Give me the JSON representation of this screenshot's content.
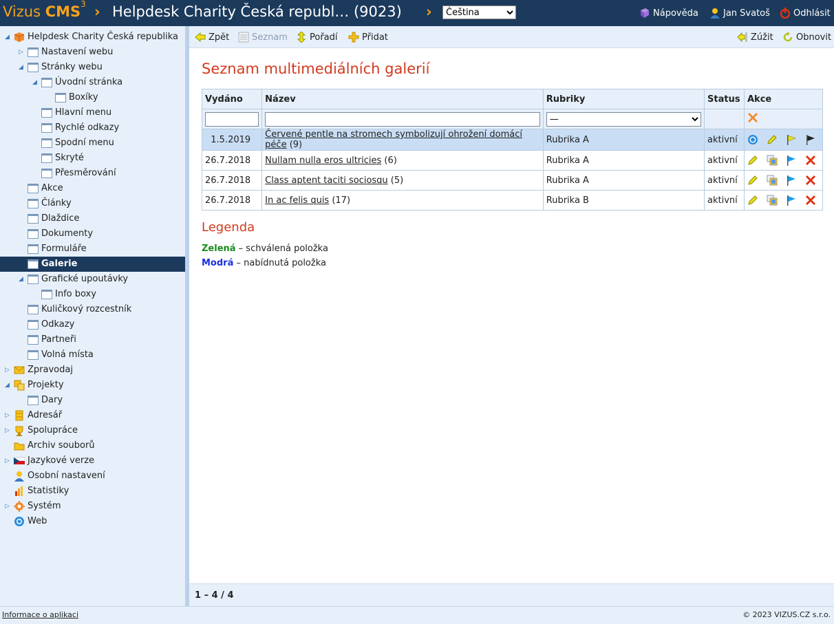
{
  "header": {
    "logo_text": "Vizus ",
    "logo_bold": "CMS",
    "logo_sup": "3",
    "site_title": "Helpdesk Charity Česká republ… (9023)",
    "language_selected": "Čeština",
    "help_label": "Nápověda",
    "user_label": "Jan Svatoš",
    "logout_label": "Odhlásit"
  },
  "sidebar": {
    "items": [
      {
        "label": "Helpdesk Charity Česká republika"
      },
      {
        "label": "Nastavení webu"
      },
      {
        "label": "Stránky webu"
      },
      {
        "label": "Úvodní stránka"
      },
      {
        "label": "Boxíky"
      },
      {
        "label": "Hlavní menu"
      },
      {
        "label": "Rychlé odkazy"
      },
      {
        "label": "Spodní menu"
      },
      {
        "label": "Skryté"
      },
      {
        "label": "Přesměrování"
      },
      {
        "label": "Akce"
      },
      {
        "label": "Články"
      },
      {
        "label": "Dlaždice"
      },
      {
        "label": "Dokumenty"
      },
      {
        "label": "Formuláře"
      },
      {
        "label": "Galerie"
      },
      {
        "label": "Grafické upoutávky"
      },
      {
        "label": "Info boxy"
      },
      {
        "label": "Kuličkový rozcestník"
      },
      {
        "label": "Odkazy"
      },
      {
        "label": "Partneři"
      },
      {
        "label": "Volná místa"
      },
      {
        "label": "Zpravodaj"
      },
      {
        "label": "Projekty"
      },
      {
        "label": "Dary"
      },
      {
        "label": "Adresář"
      },
      {
        "label": "Spolupráce"
      },
      {
        "label": "Archiv souborů"
      },
      {
        "label": "Jazykové verze"
      },
      {
        "label": "Osobní nastavení"
      },
      {
        "label": "Statistiky"
      },
      {
        "label": "Systém"
      },
      {
        "label": "Web"
      }
    ]
  },
  "toolbar": {
    "back_label": "Zpět",
    "list_label": "Seznam",
    "order_label": "Pořadí",
    "add_label": "Přidat",
    "narrow_label": "Zúžit",
    "refresh_label": "Obnovit"
  },
  "main": {
    "title": "Seznam multimediálních galerií",
    "columns": [
      "Vydáno",
      "Název",
      "Rubriky",
      "Status",
      "Akce"
    ],
    "filter_category": "—",
    "rows": [
      {
        "date": "1.5.2019",
        "name": "Červené pentle na stromech symbolizují ohrožení domácí péče",
        "count": "(9)",
        "category": "Rubrika A",
        "status": "aktivní"
      },
      {
        "date": "26.7.2018",
        "name": "Nullam nulla eros ultricies",
        "count": "(6)",
        "category": "Rubrika A",
        "status": "aktivní"
      },
      {
        "date": "26.7.2018",
        "name": "Class aptent taciti sociosqu",
        "count": "(5)",
        "category": "Rubrika A",
        "status": "aktivní"
      },
      {
        "date": "26.7.2018",
        "name": "In ac felis quis",
        "count": "(17)",
        "category": "Rubrika B",
        "status": "aktivní"
      }
    ]
  },
  "legend": {
    "title": "Legenda",
    "green_label": "Zelená",
    "green_text": " – schválená položka",
    "blue_label": "Modrá",
    "blue_text": " – nabídnutá položka"
  },
  "pager": {
    "text": "1 – 4 / 4"
  },
  "footer": {
    "info_link": "Informace o aplikaci",
    "copyright": "© 2023 VIZUS.CZ s.r.o."
  },
  "colors": {
    "header_bg": "#1b3a5c",
    "accent_orange": "#f7a11a",
    "title_red": "#d23a1e",
    "panel_bg": "#e7f0fa",
    "highlight_row": "#c9def5"
  }
}
